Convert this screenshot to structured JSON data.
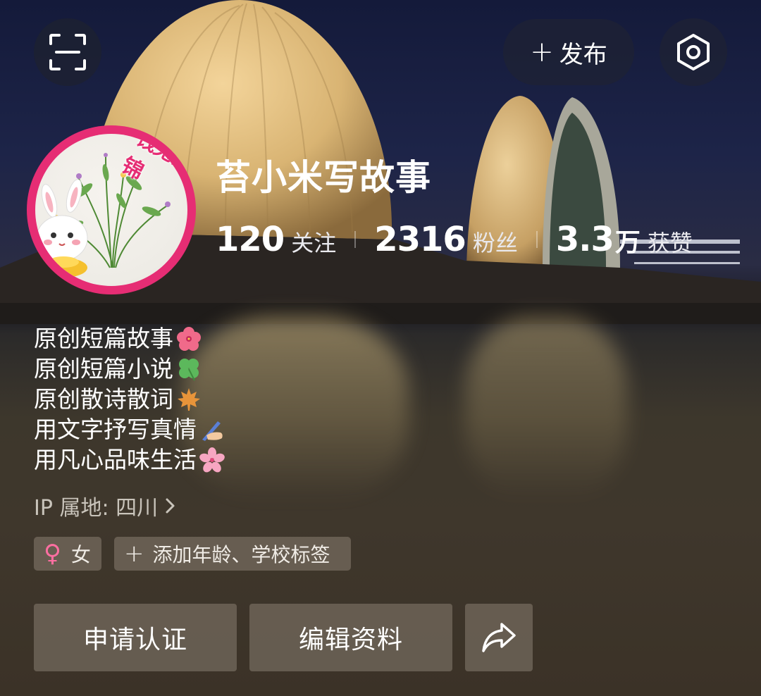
{
  "topbar": {
    "scan_icon": "scan-icon",
    "publish_label": "发布",
    "settings_icon": "settings-hexagon-icon"
  },
  "profile": {
    "avatar_text": "钱兔似锦",
    "nickname": "苔小米写故事",
    "stats": [
      {
        "value": "120",
        "unit": "",
        "label": "关注"
      },
      {
        "value": "2316",
        "unit": "",
        "label": "粉丝"
      },
      {
        "value": "3.3",
        "unit": "万",
        "label": "获赞"
      }
    ]
  },
  "bio": [
    {
      "text": "原创短篇故事",
      "emoji": "hibiscus"
    },
    {
      "text": "原创短篇小说",
      "emoji": "four-leaf-clover"
    },
    {
      "text": "原创散诗散词",
      "emoji": "maple-leaf"
    },
    {
      "text": "用文字抒写真情",
      "emoji": "writing-hand"
    },
    {
      "text": "用凡心品味生活",
      "emoji": "cherry-blossom"
    }
  ],
  "ip_location": "IP 属地: 四川",
  "tags": {
    "gender": "女",
    "add_label": "添加年龄、学校标签"
  },
  "actions": {
    "verify_label": "申请认证",
    "edit_label": "编辑资料",
    "share_icon": "share-arrow-icon"
  }
}
